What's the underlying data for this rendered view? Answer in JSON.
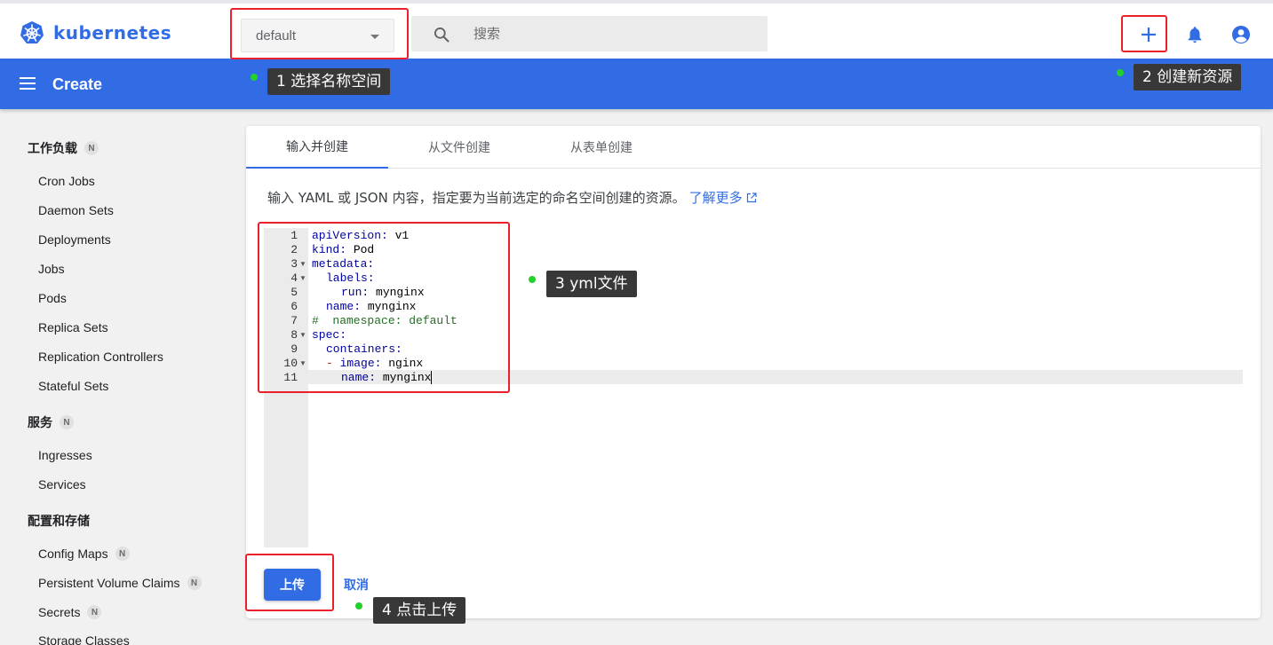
{
  "header": {
    "logo_text": "kubernetes",
    "namespace": {
      "selected": "default"
    },
    "search": {
      "placeholder": "搜索"
    },
    "icons": [
      "kubernetes-logo-icon",
      "search-icon",
      "plus-icon",
      "bell-icon",
      "account-circle-icon"
    ]
  },
  "appbar": {
    "title": "Create"
  },
  "sidebar": {
    "workloads": {
      "label": "工作负载",
      "badge": "N",
      "items": [
        "Cron Jobs",
        "Daemon Sets",
        "Deployments",
        "Jobs",
        "Pods",
        "Replica Sets",
        "Replication Controllers",
        "Stateful Sets"
      ]
    },
    "services": {
      "label": "服务",
      "badge": "N",
      "items": [
        "Ingresses",
        "Services"
      ]
    },
    "config": {
      "label": "配置和存储",
      "items": [
        {
          "label": "Config Maps",
          "badge": "N"
        },
        {
          "label": "Persistent Volume Claims",
          "badge": "N"
        },
        {
          "label": "Secrets",
          "badge": "N"
        },
        {
          "label": "Storage Classes"
        }
      ]
    }
  },
  "main": {
    "tabs": [
      "输入并创建",
      "从文件创建",
      "从表单创建"
    ],
    "active_tab": 0,
    "description": "输入 YAML 或 JSON 内容，指定要为当前选定的命名空间创建的资源。",
    "learn_more": "了解更多",
    "editor": {
      "line_numbers": [
        "1",
        "2",
        "3",
        "4",
        "5",
        "6",
        "7",
        "8",
        "9",
        "10",
        "11"
      ],
      "lines": {
        "l1k": "apiVersion:",
        "l1v": " v1",
        "l2k": "kind:",
        "l2v": " Pod",
        "l3k": "metadata:",
        "l4k": "labels:",
        "l5k": "run:",
        "l5v": " mynginx",
        "l6k": "name:",
        "l6v": " mynginx",
        "l7c": "#  namespace: default",
        "l8k": "spec:",
        "l9k": "containers:",
        "l10d": "- ",
        "l10k": "image:",
        "l10v": " nginx",
        "l11k": "name:",
        "l11v": " mynginx"
      }
    },
    "upload_label": "上传",
    "cancel_label": "取消"
  },
  "annotations": {
    "step1": "1 选择名称空间",
    "step2": "2 创建新资源",
    "step3": "3 yml文件",
    "step4": "4 点击上传",
    "box_color": "#e8212b",
    "dot_color": "#22d12a"
  },
  "colors": {
    "brand": "#326ce5",
    "keyword": "#0000a2",
    "comment": "#236e24"
  }
}
